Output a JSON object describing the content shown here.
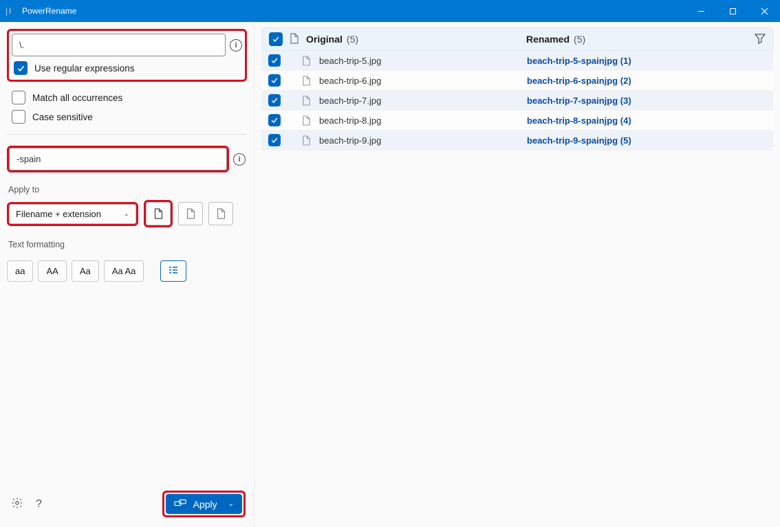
{
  "window": {
    "title": "PowerRename"
  },
  "search": {
    "value": "\\.",
    "use_regex_label": "Use regular expressions",
    "use_regex_checked": true,
    "match_all_label": "Match all occurrences",
    "match_all_checked": false,
    "case_sensitive_label": "Case sensitive",
    "case_sensitive_checked": false
  },
  "replace": {
    "value": "-spain"
  },
  "apply_to": {
    "label": "Apply to",
    "selected": "Filename + extension"
  },
  "formatting": {
    "label": "Text formatting",
    "btn_lower": "aa",
    "btn_upper": "AA",
    "btn_title": "Aa",
    "btn_each": "Aa Aa"
  },
  "apply_button": "Apply",
  "list": {
    "original_header": "Original",
    "original_count": "(5)",
    "renamed_header": "Renamed",
    "renamed_count": "(5)",
    "rows": [
      {
        "original": "beach-trip-5.jpg",
        "renamed": "beach-trip-5-spainjpg (1)"
      },
      {
        "original": "beach-trip-6.jpg",
        "renamed": "beach-trip-6-spainjpg (2)"
      },
      {
        "original": "beach-trip-7.jpg",
        "renamed": "beach-trip-7-spainjpg (3)"
      },
      {
        "original": "beach-trip-8.jpg",
        "renamed": "beach-trip-8-spainjpg (4)"
      },
      {
        "original": "beach-trip-9.jpg",
        "renamed": "beach-trip-9-spainjpg (5)"
      }
    ]
  }
}
